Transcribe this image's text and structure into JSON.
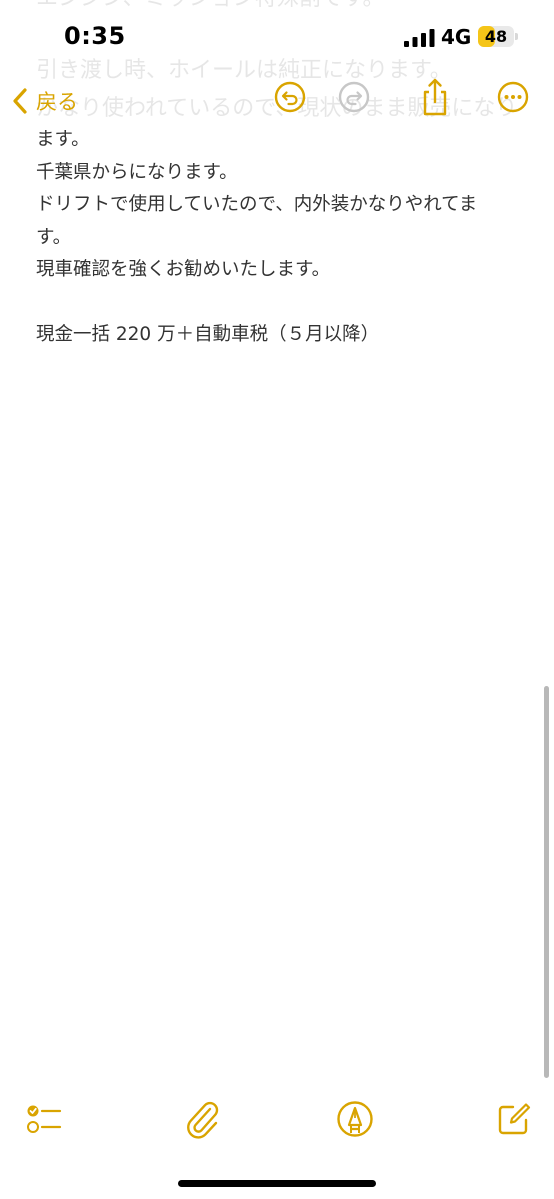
{
  "status_bar": {
    "time": "0:35",
    "network": "4G",
    "battery_level": "48",
    "battery_fraction": 0.48
  },
  "nav": {
    "back_label": "戻る"
  },
  "background_text": [
    "エンジン、ミッション特殊割です。",
    "引き渡し時、ホイールは純正になります。",
    "かなり使われているので、現状のまま販売になりま"
  ],
  "note": {
    "lines": [
      "ます。",
      "千葉県からになります。",
      "ドリフトで使用していたので、内外装かなりやれてま",
      "す。",
      "現車確認を強くお勧めいたします。",
      "",
      "現金一括 220 万＋自動車税（５月以降）"
    ]
  },
  "colors": {
    "accent": "#D9A400",
    "text": "#333333",
    "disabled": "#C7C7C7"
  },
  "icons": {
    "back": "chevron-left-icon",
    "undo": "undo-icon",
    "redo": "redo-icon",
    "share": "share-icon",
    "more": "ellipsis-circle-icon",
    "checklist": "checklist-icon",
    "attach": "paperclip-icon",
    "markup": "pen-tip-icon",
    "compose": "compose-icon"
  }
}
